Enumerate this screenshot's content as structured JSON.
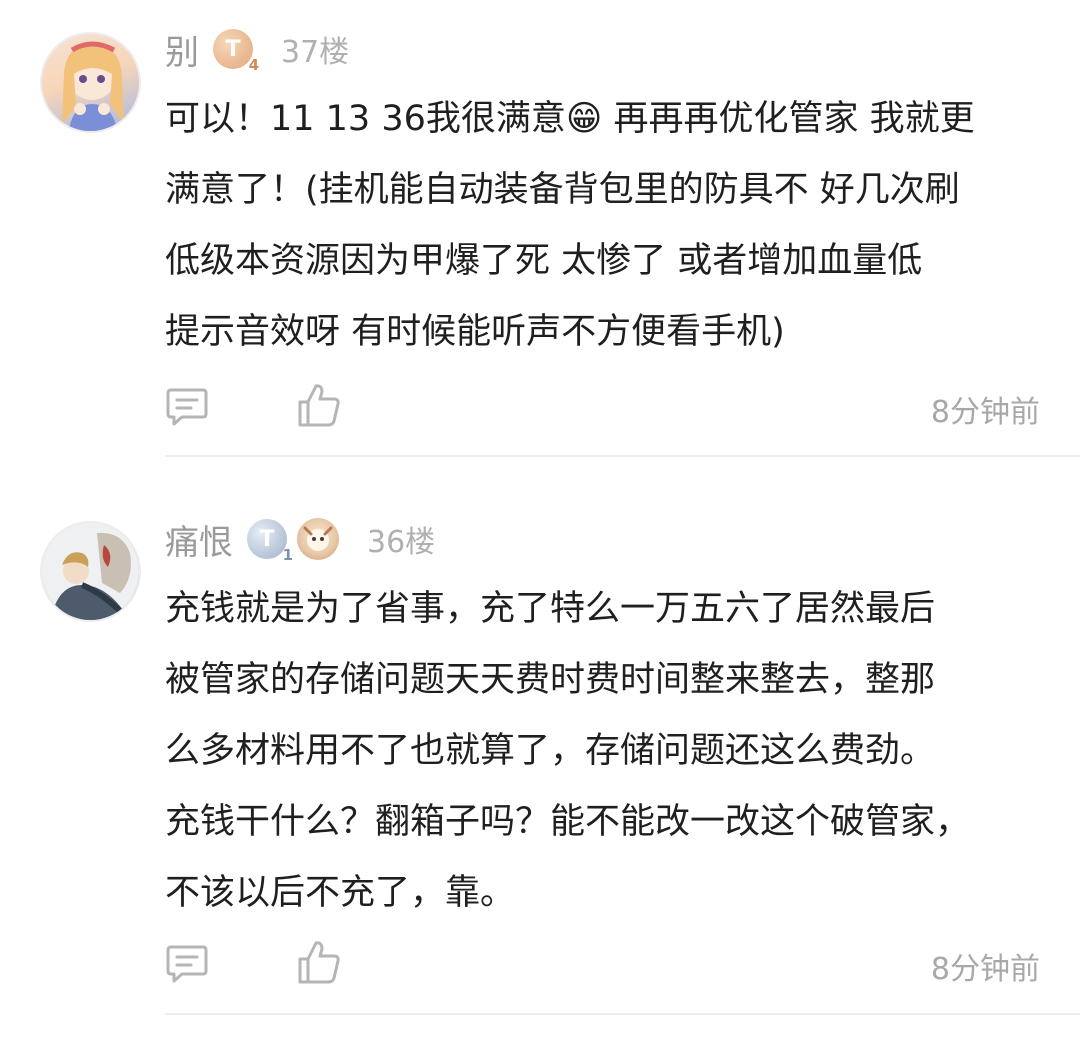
{
  "comments": [
    {
      "author": "别",
      "level": {
        "letter": "T",
        "num": "4"
      },
      "floor": "37楼",
      "text": "可以！11 13 36我很满意😁 再再再优化管家 我就更\n满意了！(挂机能自动装备背包里的防具不 好几次刷\n低级本资源因为甲爆了死 太惨了 或者增加血量低\n提示音效呀 有时候能听声不方便看手机)",
      "timestamp": "8分钟前",
      "icons": {
        "reply": "comment-icon",
        "like": "thumbs-up-icon"
      }
    },
    {
      "author": "痛恨",
      "level": {
        "letter": "T",
        "num": "1"
      },
      "floor": "36楼",
      "text": "充钱就是为了省事，充了特么一万五六了居然最后\n被管家的存储问题天天费时费时间整来整去，整那\n么多材料用不了也就算了，存储问题还这么费劲。\n充钱干什么？翻箱子吗？能不能改一改这个破管家，\n不该以后不充了，靠。",
      "timestamp": "8分钟前",
      "icons": {
        "reply": "comment-icon",
        "like": "thumbs-up-icon"
      }
    }
  ]
}
